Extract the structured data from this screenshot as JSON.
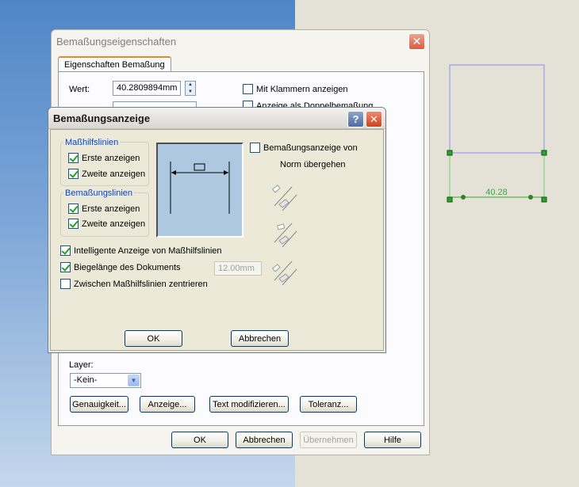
{
  "back_dialog": {
    "title": "Bemaßungseigenschaften",
    "close_symbol": "✕",
    "tab_label": "Eigenschaften Bemaßung",
    "value_label": "Wert:",
    "value": "40.2809894mm",
    "mit_klammern_label": "Mit Klammern anzeigen",
    "doppel_label": "Anzeige als Doppelbemaßung",
    "layer_label": "Layer:",
    "layer_value": "-Kein-",
    "buttons": {
      "genauigkeit": "Genauigkeit...",
      "anzeige": "Anzeige...",
      "text_modifizieren": "Text modifizieren...",
      "toleranz": "Toleranz...",
      "ok": "OK",
      "abbrechen": "Abbrechen",
      "uebernehmen": "Übernehmen",
      "hilfe": "Hilfe"
    }
  },
  "front_dialog": {
    "title": "Bemaßungsanzeige",
    "help_symbol": "?",
    "close_symbol": "✕",
    "group_hilfslinien": {
      "title": "Maßhilfslinien",
      "first": "Erste anzeigen",
      "second": "Zweite anzeigen"
    },
    "group_bemassungslinien": {
      "title": "Bemaßungslinien",
      "first": "Erste anzeigen",
      "second": "Zweite anzeigen"
    },
    "norm_label_line1": "Bemaßungsanzeige von",
    "norm_label_line2": "Norm übergehen",
    "intelligente_label": "Intelligente Anzeige von Maßhilfslinien",
    "biegelaenge_label": "Biegelänge des Dokuments",
    "biegelaenge_value": "12.00mm",
    "zentrieren_label": "Zwischen Maßhilfslinien zentrieren",
    "ok": "OK",
    "abbrechen": "Abbrechen"
  },
  "checkbox_states": {
    "mit_klammern": false,
    "doppel": false,
    "hilfs_first": true,
    "hilfs_second": true,
    "bem_first": true,
    "bem_second": true,
    "norm": false,
    "intelligente": true,
    "biegelaenge": true,
    "zentrieren": false
  },
  "sketch": {
    "dimension_value": "40.28"
  },
  "colors": {
    "sketch_outline": "#8a90f0",
    "sketch_dimension": "#3aa83a",
    "accent_tab": "#e68b2c",
    "group_title": "#0046d5"
  },
  "icons": {
    "arrow_icon_1": "dimension-arrow-1-icon",
    "arrow_icon_2": "dimension-arrow-2-icon",
    "arrow_icon_3": "dimension-arrow-3-icon"
  }
}
